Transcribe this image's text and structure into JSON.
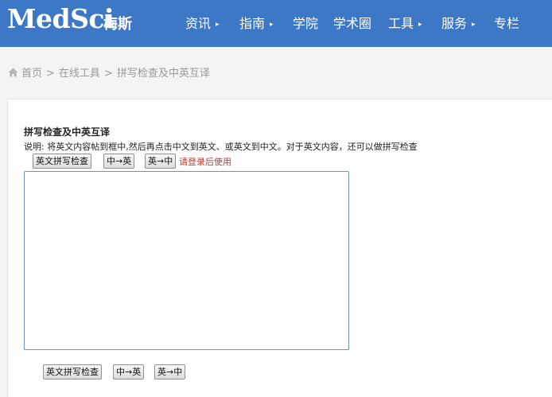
{
  "header": {
    "logo": "MedSci",
    "logo_cn": "梅斯",
    "nav": [
      {
        "label": "资讯",
        "has_arrow": true
      },
      {
        "label": "指南",
        "has_arrow": true
      },
      {
        "label": "学院",
        "has_arrow": false
      },
      {
        "label": "学术圈",
        "has_arrow": false
      },
      {
        "label": "工具",
        "has_arrow": true
      },
      {
        "label": "服务",
        "has_arrow": true
      },
      {
        "label": "专栏",
        "has_arrow": false
      }
    ],
    "arrow_glyph": "▸"
  },
  "breadcrumb": {
    "home": "首页",
    "items": [
      "在线工具",
      "拼写检查及中英互译"
    ],
    "separator": ">"
  },
  "tool": {
    "title": "拼写检查及中英互译",
    "description": "说明: 将英文内容帖到框中,然后再点击中文到英文、或英文到中文。对于英文内容，还可以做拼写检查",
    "buttons": {
      "spell_check": "英文拼写检查",
      "zh_to_en": "中→英",
      "en_to_zh": "英→中"
    },
    "login_note": "请登录后使用",
    "editor_value": ""
  },
  "colors": {
    "header_bg": "#3d78c6",
    "login_note": "#c0392b",
    "editor_border": "#6f8fc4"
  }
}
